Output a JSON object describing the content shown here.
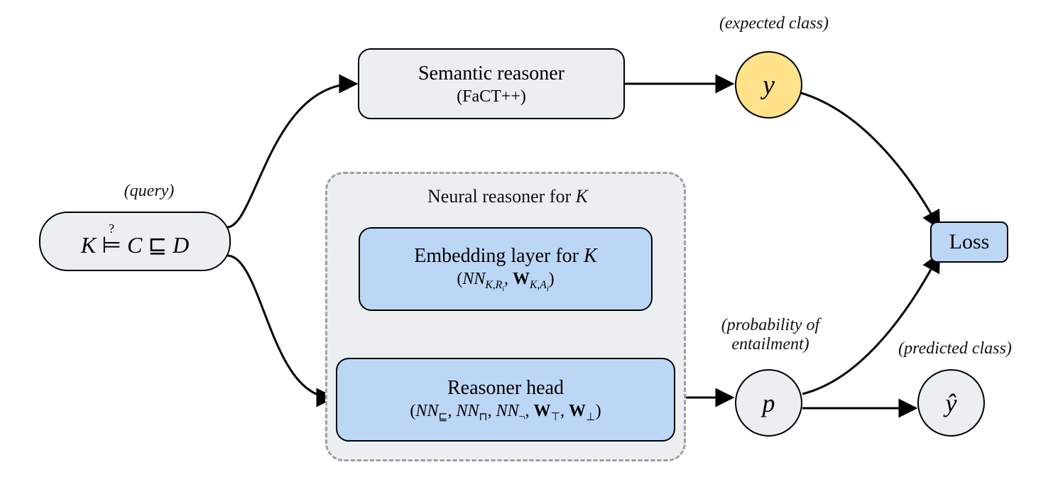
{
  "captions": {
    "query": "(query)",
    "expected_class": "(expected class)",
    "probability": "(probability of\nentailment)",
    "predicted_class": "(predicted class)"
  },
  "nodes": {
    "query_html": "<span class='scr'>K</span> <span class='stack'><span class='top'>?</span><span class='bot'>&#x22A8;</span></span> <span class='ital'>C</span> &#8849; <span class='ital'>D</span>",
    "semantic_title": "Semantic reasoner",
    "semantic_sub": "(FaCT++)",
    "neural_panel_title_html": "Neural reasoner for <span class='scr'>K</span>",
    "embed_title_html": "Embedding layer for <span class='scr'>K</span>",
    "embed_sub_html": "(<span class='ital'>NN</span><span class='sub scr'>K,R<span class='sub ital'>i</span></span>, <span class='bold'>W</span><span class='sub scr'>K,A<span class='sub ital'>i</span></span>)",
    "head_title": "Reasoner head",
    "head_sub_html": "(<span class='ital'>NN</span><span class='sub'>&#8849;</span>, <span class='ital'>NN</span><span class='sub'>&#8851;</span>, <span class='ital'>NN</span><span class='sub'>&#172;</span>, <span class='bold'>W</span><span class='sub'>&#8868;</span>, <span class='bold'>W</span><span class='sub'>&#8869;</span>)",
    "y": "y",
    "p": "p",
    "yhat_html": "<span class='ital'>y&#x0302;</span>",
    "loss": "Loss"
  }
}
